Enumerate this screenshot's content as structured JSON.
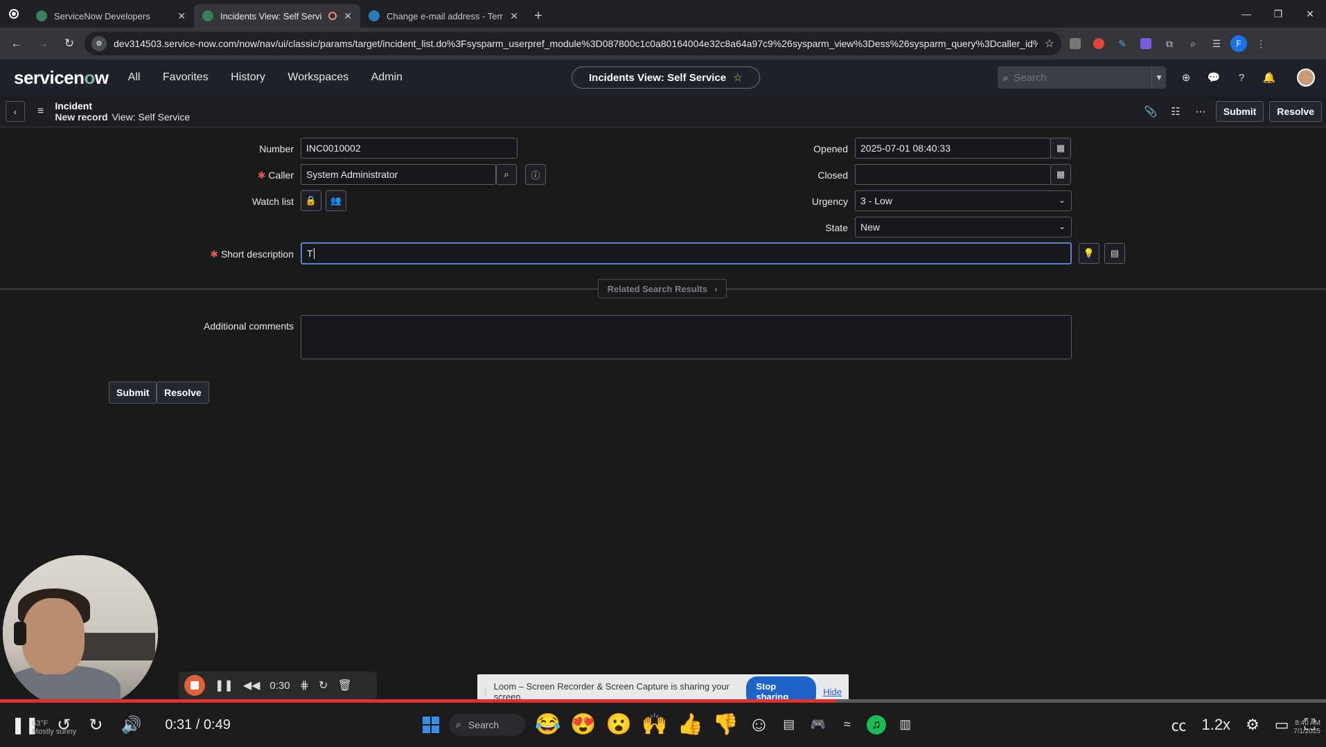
{
  "browser": {
    "tabs": [
      {
        "title": "ServiceNow Developers",
        "active": false
      },
      {
        "title": "Incidents View: Self Service",
        "active": true
      },
      {
        "title": "Change e-mail address - Temp",
        "active": false
      }
    ],
    "url": "dev314503.service-now.com/now/nav/ui/classic/params/target/incident_list.do%3Fsysparm_userpref_module%3D087800c1c0a80164004e32c8a64a97c9%26sysparm_view%3Dess%26sysparm_query%3Dcaller_id%253...",
    "profile_initial": "F"
  },
  "header": {
    "logo_pre": "servicen",
    "logo_o": "o",
    "logo_post": "w",
    "menu": [
      "All",
      "Favorites",
      "History",
      "Workspaces",
      "Admin"
    ],
    "context_title": "Incidents View: Self Service",
    "search_placeholder": "Search"
  },
  "record": {
    "type": "Incident",
    "state_label": "New record",
    "view_label": "View: Self Service",
    "submit_label": "Submit",
    "resolve_label": "Resolve"
  },
  "form": {
    "number_label": "Number",
    "number_value": "INC0010002",
    "caller_label": "Caller",
    "caller_value": "System Administrator",
    "watchlist_label": "Watch list",
    "opened_label": "Opened",
    "opened_value": "2025-07-01 08:40:33",
    "closed_label": "Closed",
    "closed_value": "",
    "urgency_label": "Urgency",
    "urgency_value": "3 - Low",
    "state_label": "State",
    "state_value": "New",
    "short_desc_label": "Short description",
    "short_desc_value": "T",
    "related_label": "Related Search Results",
    "comments_label": "Additional comments",
    "comments_value": "",
    "submit_label": "Submit",
    "resolve_label": "Resolve"
  },
  "loom": {
    "elapsed": "0:30",
    "share_text": "Loom – Screen Recorder & Screen Capture is sharing your screen.",
    "stop_label": "Stop sharing",
    "hide_label": "Hide"
  },
  "player": {
    "time": "0:31 / 0:49",
    "progress": 0.63,
    "speed": "1.2x",
    "weather_temp": "63°F",
    "weather_desc": "Mostly sunny",
    "taskbar_search": "Search",
    "clock_time": "8:40 AM",
    "clock_date": "7/1/2025"
  },
  "colors": {
    "accent_focus": "#5b82c8",
    "required": "#e05a5a",
    "progress": "#e03131",
    "share_button": "#1e63c7"
  }
}
